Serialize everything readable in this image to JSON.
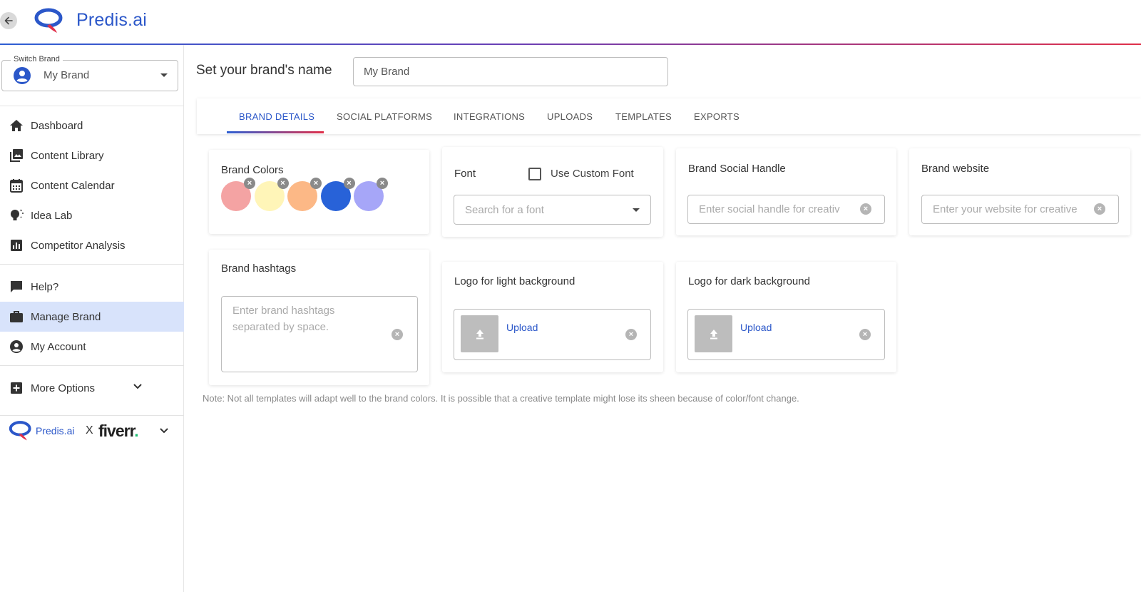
{
  "header": {
    "app_name": "Predis.ai",
    "brand_color": "#2b57c9"
  },
  "sidebar": {
    "switch_brand": {
      "label": "Switch Brand",
      "value": "My Brand"
    },
    "nav_primary": [
      {
        "label": "Dashboard",
        "icon": "home-icon"
      },
      {
        "label": "Content Library",
        "icon": "gallery-icon"
      },
      {
        "label": "Content Calendar",
        "icon": "calendar-icon"
      },
      {
        "label": "Idea Lab",
        "icon": "lightbulb-icon"
      },
      {
        "label": "Competitor Analysis",
        "icon": "bar-chart-icon"
      }
    ],
    "nav_secondary": [
      {
        "label": "Help?",
        "icon": "chat-icon"
      },
      {
        "label": "Manage Brand",
        "icon": "briefcase-icon",
        "active": true
      },
      {
        "label": "My Account",
        "icon": "account-icon"
      }
    ],
    "more_options": "More Options",
    "partner": {
      "predis_label": "Predis.ai",
      "x_label": "X",
      "fiverr_label": "fiverr",
      "fiverr_dot": "."
    }
  },
  "main": {
    "brand_name_label": "Set your brand's name",
    "brand_name_value": "My Brand",
    "tabs": [
      {
        "label": "BRAND DETAILS",
        "active": true
      },
      {
        "label": "SOCIAL PLATFORMS"
      },
      {
        "label": "INTEGRATIONS"
      },
      {
        "label": "UPLOADS"
      },
      {
        "label": "TEMPLATES"
      },
      {
        "label": "EXPORTS"
      }
    ],
    "brand_colors": {
      "title": "Brand Colors",
      "colors": [
        "#f4a3a3",
        "#fff5b8",
        "#fcb886",
        "#2862d8",
        "#a6a6f8"
      ]
    },
    "font": {
      "title": "Font",
      "custom_font_label": "Use Custom Font",
      "custom_font_checked": false,
      "search_placeholder": "Search for a font"
    },
    "social_handle": {
      "title": "Brand Social Handle",
      "placeholder": "Enter social handle for creativ"
    },
    "website": {
      "title": "Brand website",
      "placeholder": "Enter your website for creative"
    },
    "hashtags": {
      "title": "Brand hashtags",
      "placeholder_line1": "Enter brand hashtags",
      "placeholder_line2": "separated by space."
    },
    "logo_light": {
      "title": "Logo for light background",
      "upload_label": "Upload"
    },
    "logo_dark": {
      "title": "Logo for dark background",
      "upload_label": "Upload"
    },
    "note": "Note: Not all templates will adapt well to the brand colors. It is possible that a creative template might lose its sheen because of color/font change."
  }
}
